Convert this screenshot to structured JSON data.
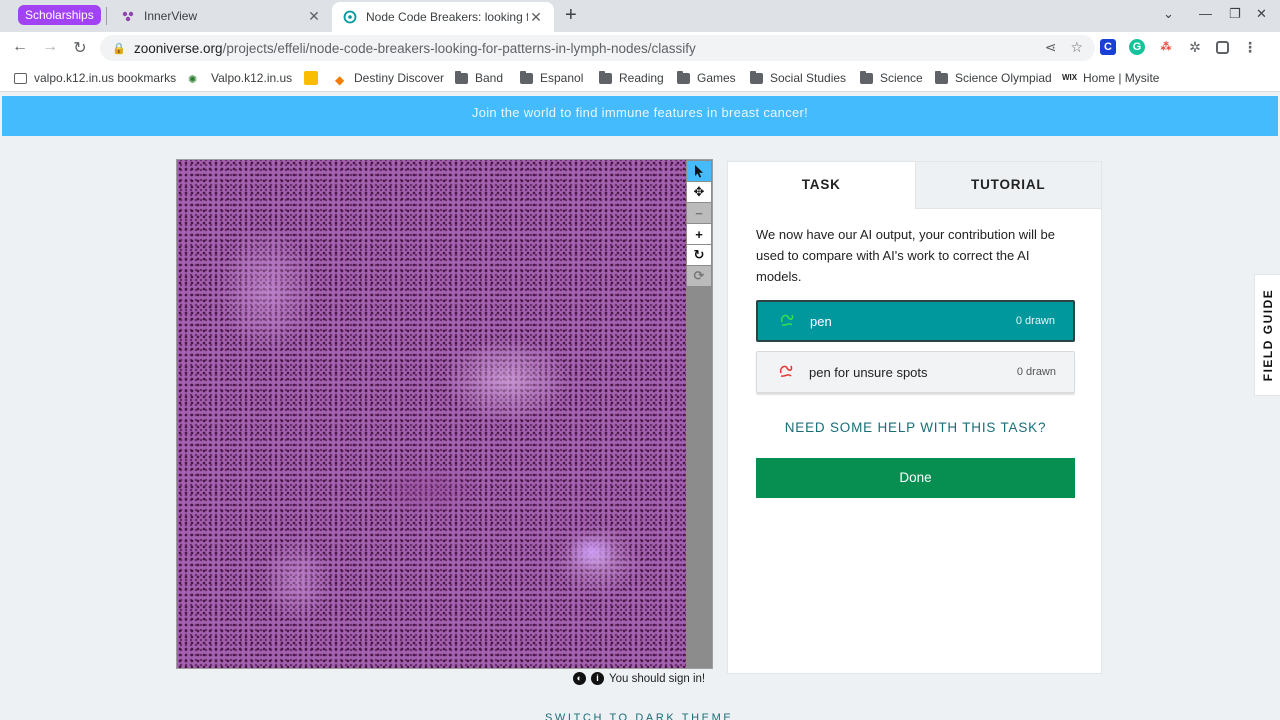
{
  "browser": {
    "tab_group": "Scholarships",
    "tabs": [
      {
        "title": "InnerView"
      },
      {
        "title": "Node Code Breakers: looking for",
        "active": true
      }
    ],
    "new_tab": "+",
    "url_host": "zooniverse.org",
    "url_path": "/projects/effeli/node-code-breakers-looking-for-patterns-in-lymph-nodes/classify",
    "bookmarks": [
      "valpo.k12.in.us bookmarks",
      "Valpo.k12.in.us",
      "Destiny Discover",
      "Band",
      "Espanol",
      "Reading",
      "Games",
      "Social Studies",
      "Science",
      "Science Olympiad",
      "Home | Mysite"
    ]
  },
  "banner": "Join the world to find immune features in breast cancer!",
  "viewer": {
    "sign_in": "You should sign in!"
  },
  "panel": {
    "tabs": {
      "task": "TASK",
      "tutorial": "TUTORIAL"
    },
    "instructions": "We now have our AI output, your contribution will be used to compare with AI's work to correct the AI models.",
    "tools": [
      {
        "label": "pen",
        "count": "0 drawn",
        "color": "#00979d"
      },
      {
        "label": "pen for unsure spots",
        "count": "0 drawn",
        "color": "#e53935"
      }
    ],
    "help": "NEED SOME HELP WITH THIS TASK?",
    "done": "Done"
  },
  "field_guide": "FIELD GUIDE",
  "dark_theme": "SWITCH TO DARK THEME",
  "colors": {
    "banner": "#43bbfd",
    "done": "#078f52",
    "tool_active": "#00979d"
  }
}
